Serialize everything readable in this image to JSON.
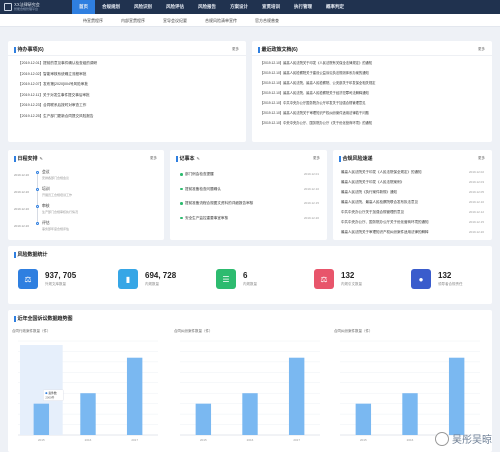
{
  "brand": {
    "title": "XX法律研究会",
    "subtitle": "智能合规管理平台"
  },
  "nav": [
    "首页",
    "合规规划",
    "风险识别",
    "风险评估",
    "风险报告",
    "方案设计",
    "宣贯培训",
    "执行管理",
    "概率判定"
  ],
  "subnav": [
    "待宣贯程序",
    "内部宣贯程序",
    "宣导会议纪要",
    "合规风险清单宣传",
    "官方合规普查"
  ],
  "todo": {
    "title": "待办事项(6)",
    "more": "更多",
    "items": [
      "【2019.12.01】提前的意见事件确认检查组的调研",
      "【2019.12.02】智能审核系统确立流程审批",
      "【2019.12.07】发布第[2020]004号风险审批",
      "【2019.12.11】关于对发生事件提交事后审批",
      "【2019.12.23】合同联系后按时对审查工作",
      "【2019.12.25】生产部门更新合同提交风险报告"
    ]
  },
  "news": {
    "title": "最近政策文档(6)",
    "more": "更多",
    "items": [
      "【2019.12.10】最高人民法院关于印发《人民法院有关保全法律规定》的通知",
      "【2019.12.10】最高人民检察院关于建设公益诉讼执法规则体系办案的通知",
      "【2019.12.10】最高人民法院，最高人民检察院、公安部关于印发保全相关规定",
      "【2019.12.10】最高人民法院、最高人民检察院关于经济犯罪司法解释通知",
      "【2019.12.10】中共中央办公厅国务院办公厅印发关于加强合规管理意见",
      "【2019.12.10】最高人民法院关于审理知识产权纠纷案件适用法律若干问题",
      "【2019.12.10】中央中央办公厅、国务院办公厅《关于优化营商环境》的通知"
    ]
  },
  "schedule": {
    "title": "日程安排",
    "more": "更多",
    "items": [
      {
        "time": "2019.12.20",
        "title": "会议",
        "desc": "安排各部门合规会议"
      },
      {
        "time": "2019.12.20",
        "title": "培训",
        "desc": "开展员工合规培训工作"
      },
      {
        "time": "2019.12.20",
        "title": "审核",
        "desc": "生产部门合规审核执行情况"
      },
      {
        "time": "2019.12.20",
        "title": "评估",
        "desc": "事务部年度合规评估"
      }
    ]
  },
  "memo": {
    "title": "记事本",
    "more": "更多",
    "items": [
      {
        "text": "部门例会检查提醒",
        "date": "2019.12.01"
      },
      {
        "text": "提前准备检查问题确认",
        "date": "2019.12.10"
      },
      {
        "text": "提前准备流程合规图文资料的详细报告审核",
        "date": "2019.12.15"
      },
      {
        "text": "安全生产监控重要事宜审核",
        "date": "2019.12.20"
      }
    ]
  },
  "laws": {
    "title": "合规风险速递",
    "more": "更多",
    "items": [
      {
        "text": "最高人民法院关于印发《人民法院保全规定》的通知",
        "date": "2019.12.02"
      },
      {
        "text": "最高人民法院关于印发《人民法院案例》",
        "date": "2019.12.03"
      },
      {
        "text": "最高人民法院《执行案件新规》通知",
        "date": "2019.12.05"
      },
      {
        "text": "最高人民法院、最高人民检察院联合发布执法意见",
        "date": "2019.12.10"
      },
      {
        "text": "中共中央办公厅关于加强合规管理的意见",
        "date": "2019.12.12"
      },
      {
        "text": "中共中央办公厅、国务院办公厅关于优化营商环境的通知",
        "date": "2019.12.15"
      },
      {
        "text": "最高人民法院关于审理知识产权纠纷案件适用法律的解释",
        "date": "2019.12.20"
      }
    ]
  },
  "stats": {
    "title": "风险数据统计",
    "items": [
      {
        "value": "937, 705",
        "label": "外规文库数量",
        "color": "#2f7fe0",
        "icon": "gavel-icon"
      },
      {
        "value": "694, 728",
        "label": "内规数量",
        "color": "#36a6e6",
        "icon": "chart-icon"
      },
      {
        "value": "6",
        "label": "内规数量",
        "color": "#2dbb6f",
        "icon": "list-icon"
      },
      {
        "value": "132",
        "label": "内规引文数量",
        "color": "#e8556b",
        "icon": "scale-icon"
      },
      {
        "value": "132",
        "label": "领导者合规责任",
        "color": "#3a5ccc",
        "icon": "user-icon"
      }
    ]
  },
  "charts_section": {
    "title": "近年全国诉讼数据趋势图"
  },
  "chart_data": [
    {
      "type": "bar",
      "ylabel": "合同行政案件数量（件）",
      "categories": [
        "2015",
        "2016",
        "2017"
      ],
      "values": [
        1500,
        2000,
        3700
      ],
      "ylim": [
        0,
        4500
      ],
      "tooltip": {
        "label": "案件数",
        "value": "2000件"
      }
    },
    {
      "type": "bar",
      "ylabel": "合同纠纷案件数量（件）",
      "categories": [
        "2015",
        "2016",
        "2017"
      ],
      "values": [
        1500,
        2000,
        3700
      ],
      "ylim": [
        0,
        4500
      ]
    },
    {
      "type": "bar",
      "ylabel": "合同纠纷案件数量（件）",
      "categories": [
        "2015",
        "2016",
        "2017"
      ],
      "values": [
        1500,
        2000,
        3700
      ],
      "ylim": [
        0,
        4500
      ]
    }
  ],
  "watermark": "吴彤吴晾"
}
